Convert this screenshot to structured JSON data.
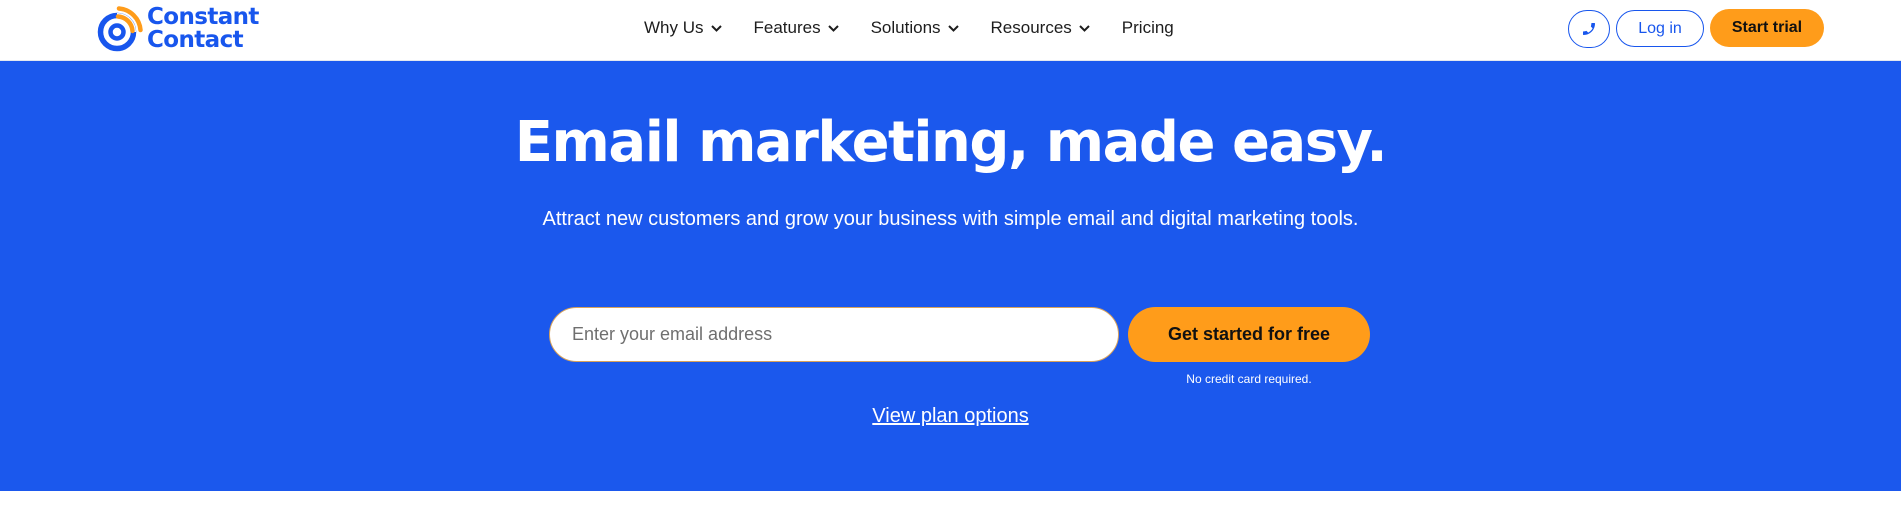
{
  "brand": {
    "name_line1": "Constant",
    "name_line2": "Contact",
    "colors": {
      "primary": "#1856ed",
      "accent": "#ff9c1a",
      "hero_bg": "#1b58ed"
    }
  },
  "nav": {
    "items": [
      {
        "label": "Why Us",
        "dropdown": true
      },
      {
        "label": "Features",
        "dropdown": true
      },
      {
        "label": "Solutions",
        "dropdown": true
      },
      {
        "label": "Resources",
        "dropdown": true
      },
      {
        "label": "Pricing",
        "dropdown": false
      }
    ],
    "phone_icon": "phone-icon",
    "login_label": "Log in",
    "trial_label": "Start trial"
  },
  "hero": {
    "title": "Email marketing, made easy.",
    "subtitle": "Attract new customers and grow your business with simple email and digital marketing tools.",
    "email_placeholder": "Enter your email address",
    "email_value": "",
    "cta_label": "Get started for free",
    "cta_note": "No credit card required.",
    "plan_link": "View plan options"
  }
}
